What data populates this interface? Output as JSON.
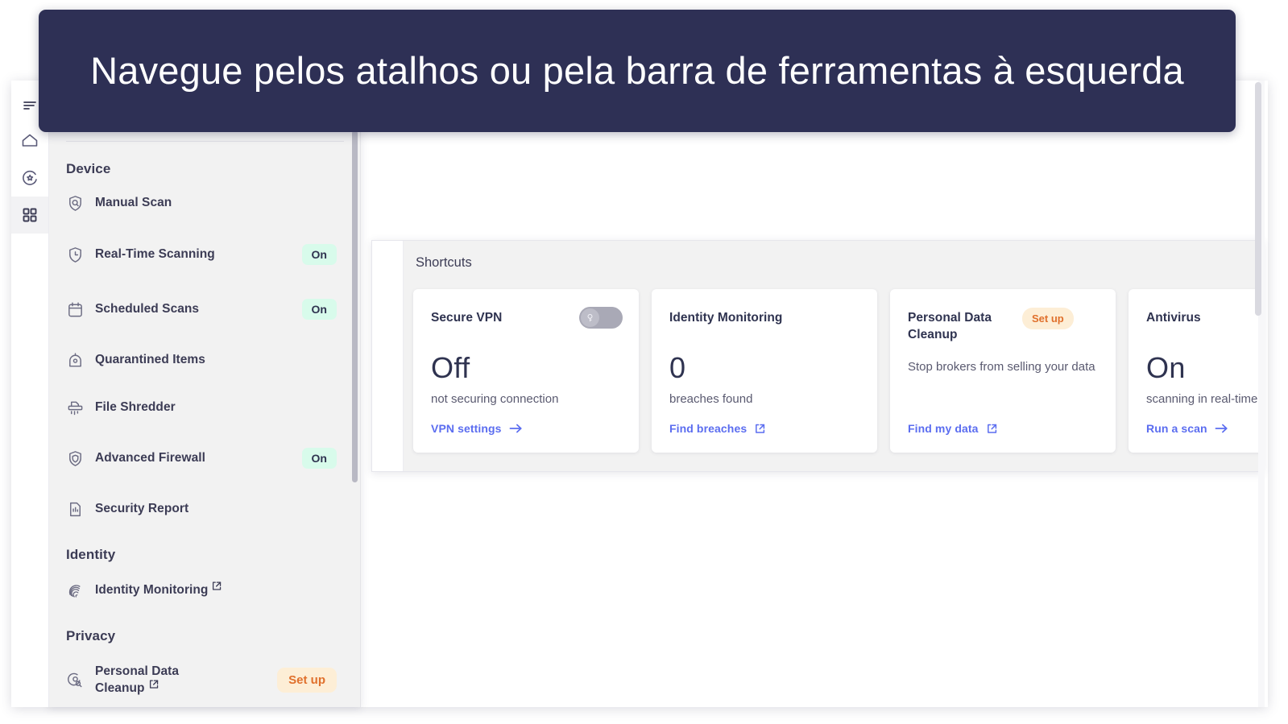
{
  "tooltip": {
    "text": "Navegue pelos atalhos ou pela barra de ferramentas à esquerda"
  },
  "colors": {
    "tooltip_bg": "#2e3055",
    "accent_link": "#5b6df0",
    "badge_on_bg": "#d8fbeb",
    "badge_on_text": "#2f3350",
    "badge_setup_bg": "#fdeed6",
    "badge_setup_text": "#e0702c",
    "panel_bg": "#f2f2f2",
    "text_primary": "#2f3350",
    "text_secondary": "#5a5a70"
  },
  "rail": {
    "items": [
      {
        "name": "menu-icon",
        "active": false
      },
      {
        "name": "home-icon",
        "active": false
      },
      {
        "name": "protection-icon",
        "active": false
      },
      {
        "name": "apps-grid-icon",
        "active": true
      }
    ]
  },
  "sidebar": {
    "groups": [
      {
        "title": "Device",
        "items": [
          {
            "label": "Manual Scan",
            "icon": "shield-search-icon",
            "badge": null,
            "external": false
          },
          {
            "label": "Real-Time Scanning",
            "icon": "shield-clock-icon",
            "badge": "On",
            "external": false
          },
          {
            "label": "Scheduled Scans",
            "icon": "calendar-icon",
            "badge": "On",
            "external": false
          },
          {
            "label": "Quarantined Items",
            "icon": "quarantine-icon",
            "badge": null,
            "external": false
          },
          {
            "label": "File Shredder",
            "icon": "shredder-icon",
            "badge": null,
            "external": false
          },
          {
            "label": "Advanced Firewall",
            "icon": "shield-firewall-icon",
            "badge": "On",
            "external": false
          },
          {
            "label": "Security Report",
            "icon": "report-icon",
            "badge": null,
            "external": false
          }
        ]
      },
      {
        "title": "Identity",
        "items": [
          {
            "label": "Identity Monitoring",
            "icon": "fingerprint-icon",
            "badge": null,
            "external": true
          }
        ]
      },
      {
        "title": "Privacy",
        "items": [
          {
            "label": "Personal Data Cleanup",
            "icon": "data-search-icon",
            "badge": "Set up",
            "external": true
          }
        ]
      }
    ]
  },
  "shortcuts": {
    "title": "Shortcuts",
    "cards": [
      {
        "title": "Secure VPN",
        "badge": null,
        "toggle": {
          "on": false,
          "icon": "vpn-key-icon"
        },
        "value": "Off",
        "subtitle": "not securing connection",
        "description": null,
        "link": {
          "label": "VPN settings",
          "icon": "arrow-right-icon"
        }
      },
      {
        "title": "Identity Monitoring",
        "badge": null,
        "toggle": null,
        "value": "0",
        "subtitle": "breaches found",
        "description": null,
        "link": {
          "label": "Find breaches",
          "icon": "external-link-icon"
        }
      },
      {
        "title": "Personal Data Cleanup",
        "badge": "Set up",
        "toggle": null,
        "value": null,
        "subtitle": null,
        "description": "Stop brokers from selling your data",
        "link": {
          "label": "Find my data",
          "icon": "external-link-icon"
        }
      },
      {
        "title": "Antivirus",
        "badge": null,
        "toggle": null,
        "value": "On",
        "subtitle": "scanning in real-time",
        "description": null,
        "link": {
          "label": "Run a scan",
          "icon": "arrow-right-icon"
        }
      }
    ]
  }
}
